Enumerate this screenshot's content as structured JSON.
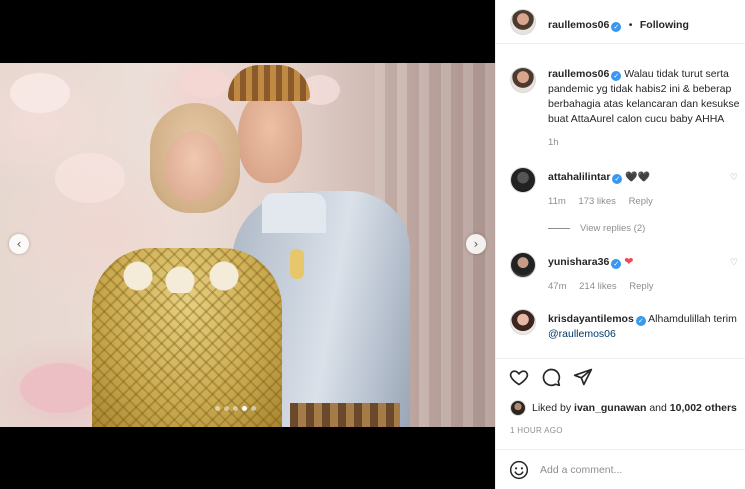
{
  "post": {
    "author": "raullemos06",
    "verified": true,
    "follow_status": "Following"
  },
  "carousel": {
    "prev_icon": "chevron-left-icon",
    "next_icon": "chevron-right-icon",
    "prev_glyph": "‹",
    "next_glyph": "›",
    "slide_count": 5,
    "active_slide": 4
  },
  "caption": {
    "username": "raullemos06",
    "lines": [
      "Walau tidak turut serta",
      "pandemic yg tidak habis2 ini & beberap",
      "berbahagia atas kelancaran dan kesukse",
      "buat AttaAurel calon cucu baby AHHA"
    ],
    "time": "1h"
  },
  "comments": [
    {
      "username": "attahalilintar",
      "text": "🖤🖤",
      "time": "11m",
      "likes": "173 likes",
      "reply": "Reply",
      "view_replies": "View replies (2)"
    },
    {
      "username": "yunishara36",
      "text": "❤",
      "time": "47m",
      "likes": "214 likes",
      "reply": "Reply"
    },
    {
      "username": "krisdayantilemos",
      "text": "Alhamdulillah terim",
      "mention": "@raullemos06"
    }
  ],
  "actions": {
    "like_icon": "heart-icon",
    "comment_icon": "comment-icon",
    "share_icon": "paper-plane-icon"
  },
  "likes": {
    "prefix": "Liked by",
    "user": "ivan_gunawan",
    "and": "and",
    "others": "10,002 others"
  },
  "timestamp": "1 HOUR AGO",
  "add_comment": {
    "emoji_icon": "smiley-icon",
    "placeholder": "Add a comment..."
  },
  "colors": {
    "verified": "#3897f0",
    "heart_red": "#ed4956",
    "muted": "#8e8e8e",
    "text": "#262626"
  }
}
